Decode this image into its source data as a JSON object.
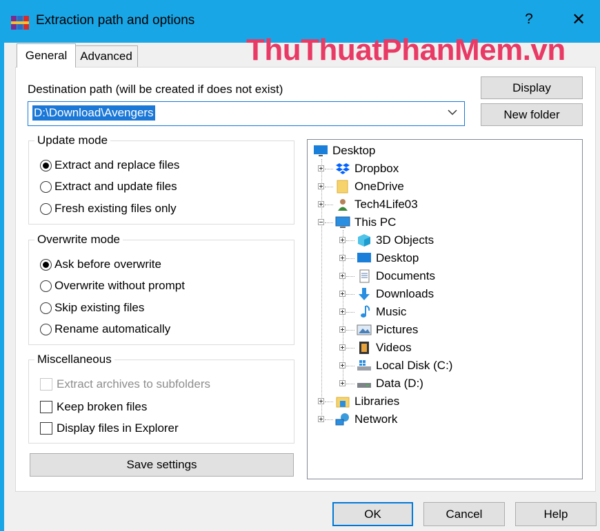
{
  "window": {
    "title": "Extraction path and options",
    "help_glyph": "?",
    "close_glyph": "✕"
  },
  "watermark": "ThuThuatPhanMem.vn",
  "tabs": [
    {
      "label": "General",
      "active": true
    },
    {
      "label": "Advanced",
      "active": false
    }
  ],
  "destination": {
    "label": "Destination path (will be created if does not exist)",
    "value": "D:\\Download\\Avengers"
  },
  "buttons": {
    "display": "Display",
    "new_folder": "New folder",
    "save_settings": "Save settings",
    "ok": "OK",
    "cancel": "Cancel",
    "help": "Help"
  },
  "update_mode": {
    "title": "Update mode",
    "options": [
      {
        "label": "Extract and replace files",
        "selected": true
      },
      {
        "label": "Extract and update files",
        "selected": false
      },
      {
        "label": "Fresh existing files only",
        "selected": false
      }
    ]
  },
  "overwrite_mode": {
    "title": "Overwrite mode",
    "options": [
      {
        "label": "Ask before overwrite",
        "selected": true
      },
      {
        "label": "Overwrite without prompt",
        "selected": false
      },
      {
        "label": "Skip existing files",
        "selected": false
      },
      {
        "label": "Rename automatically",
        "selected": false
      }
    ]
  },
  "miscellaneous": {
    "title": "Miscellaneous",
    "options": [
      {
        "label": "Extract archives to subfolders",
        "checked": false,
        "enabled": false
      },
      {
        "label": "Keep broken files",
        "checked": false,
        "enabled": true
      },
      {
        "label": "Display files in Explorer",
        "checked": false,
        "enabled": true
      }
    ]
  },
  "tree": {
    "root": {
      "label": "Desktop",
      "icon": "desktop-icon"
    },
    "items": [
      {
        "label": "Dropbox",
        "icon": "dropbox-icon",
        "level": 1,
        "expander": "plus"
      },
      {
        "label": "OneDrive",
        "icon": "onedrive-folder-icon",
        "level": 1,
        "expander": "plus"
      },
      {
        "label": "Tech4Life03",
        "icon": "user-icon",
        "level": 1,
        "expander": "plus"
      },
      {
        "label": "This PC",
        "icon": "computer-icon",
        "level": 1,
        "expander": "minus"
      },
      {
        "label": "3D Objects",
        "icon": "3d-objects-icon",
        "level": 2,
        "expander": "plus"
      },
      {
        "label": "Desktop",
        "icon": "desktop-icon",
        "level": 2,
        "expander": "plus"
      },
      {
        "label": "Documents",
        "icon": "documents-icon",
        "level": 2,
        "expander": "plus"
      },
      {
        "label": "Downloads",
        "icon": "downloads-icon",
        "level": 2,
        "expander": "plus"
      },
      {
        "label": "Music",
        "icon": "music-icon",
        "level": 2,
        "expander": "plus"
      },
      {
        "label": "Pictures",
        "icon": "pictures-icon",
        "level": 2,
        "expander": "plus"
      },
      {
        "label": "Videos",
        "icon": "videos-icon",
        "level": 2,
        "expander": "plus"
      },
      {
        "label": "Local Disk (C:)",
        "icon": "local-disk-icon",
        "level": 2,
        "expander": "plus"
      },
      {
        "label": "Data (D:)",
        "icon": "drive-icon",
        "level": 2,
        "expander": "plus"
      },
      {
        "label": "Libraries",
        "icon": "libraries-icon",
        "level": 1,
        "expander": "plus"
      },
      {
        "label": "Network",
        "icon": "network-icon",
        "level": 1,
        "expander": "plus"
      }
    ]
  },
  "colors": {
    "titlebar": "#19a6e6",
    "selection": "#1c78d7",
    "watermark": "#e83a65"
  }
}
